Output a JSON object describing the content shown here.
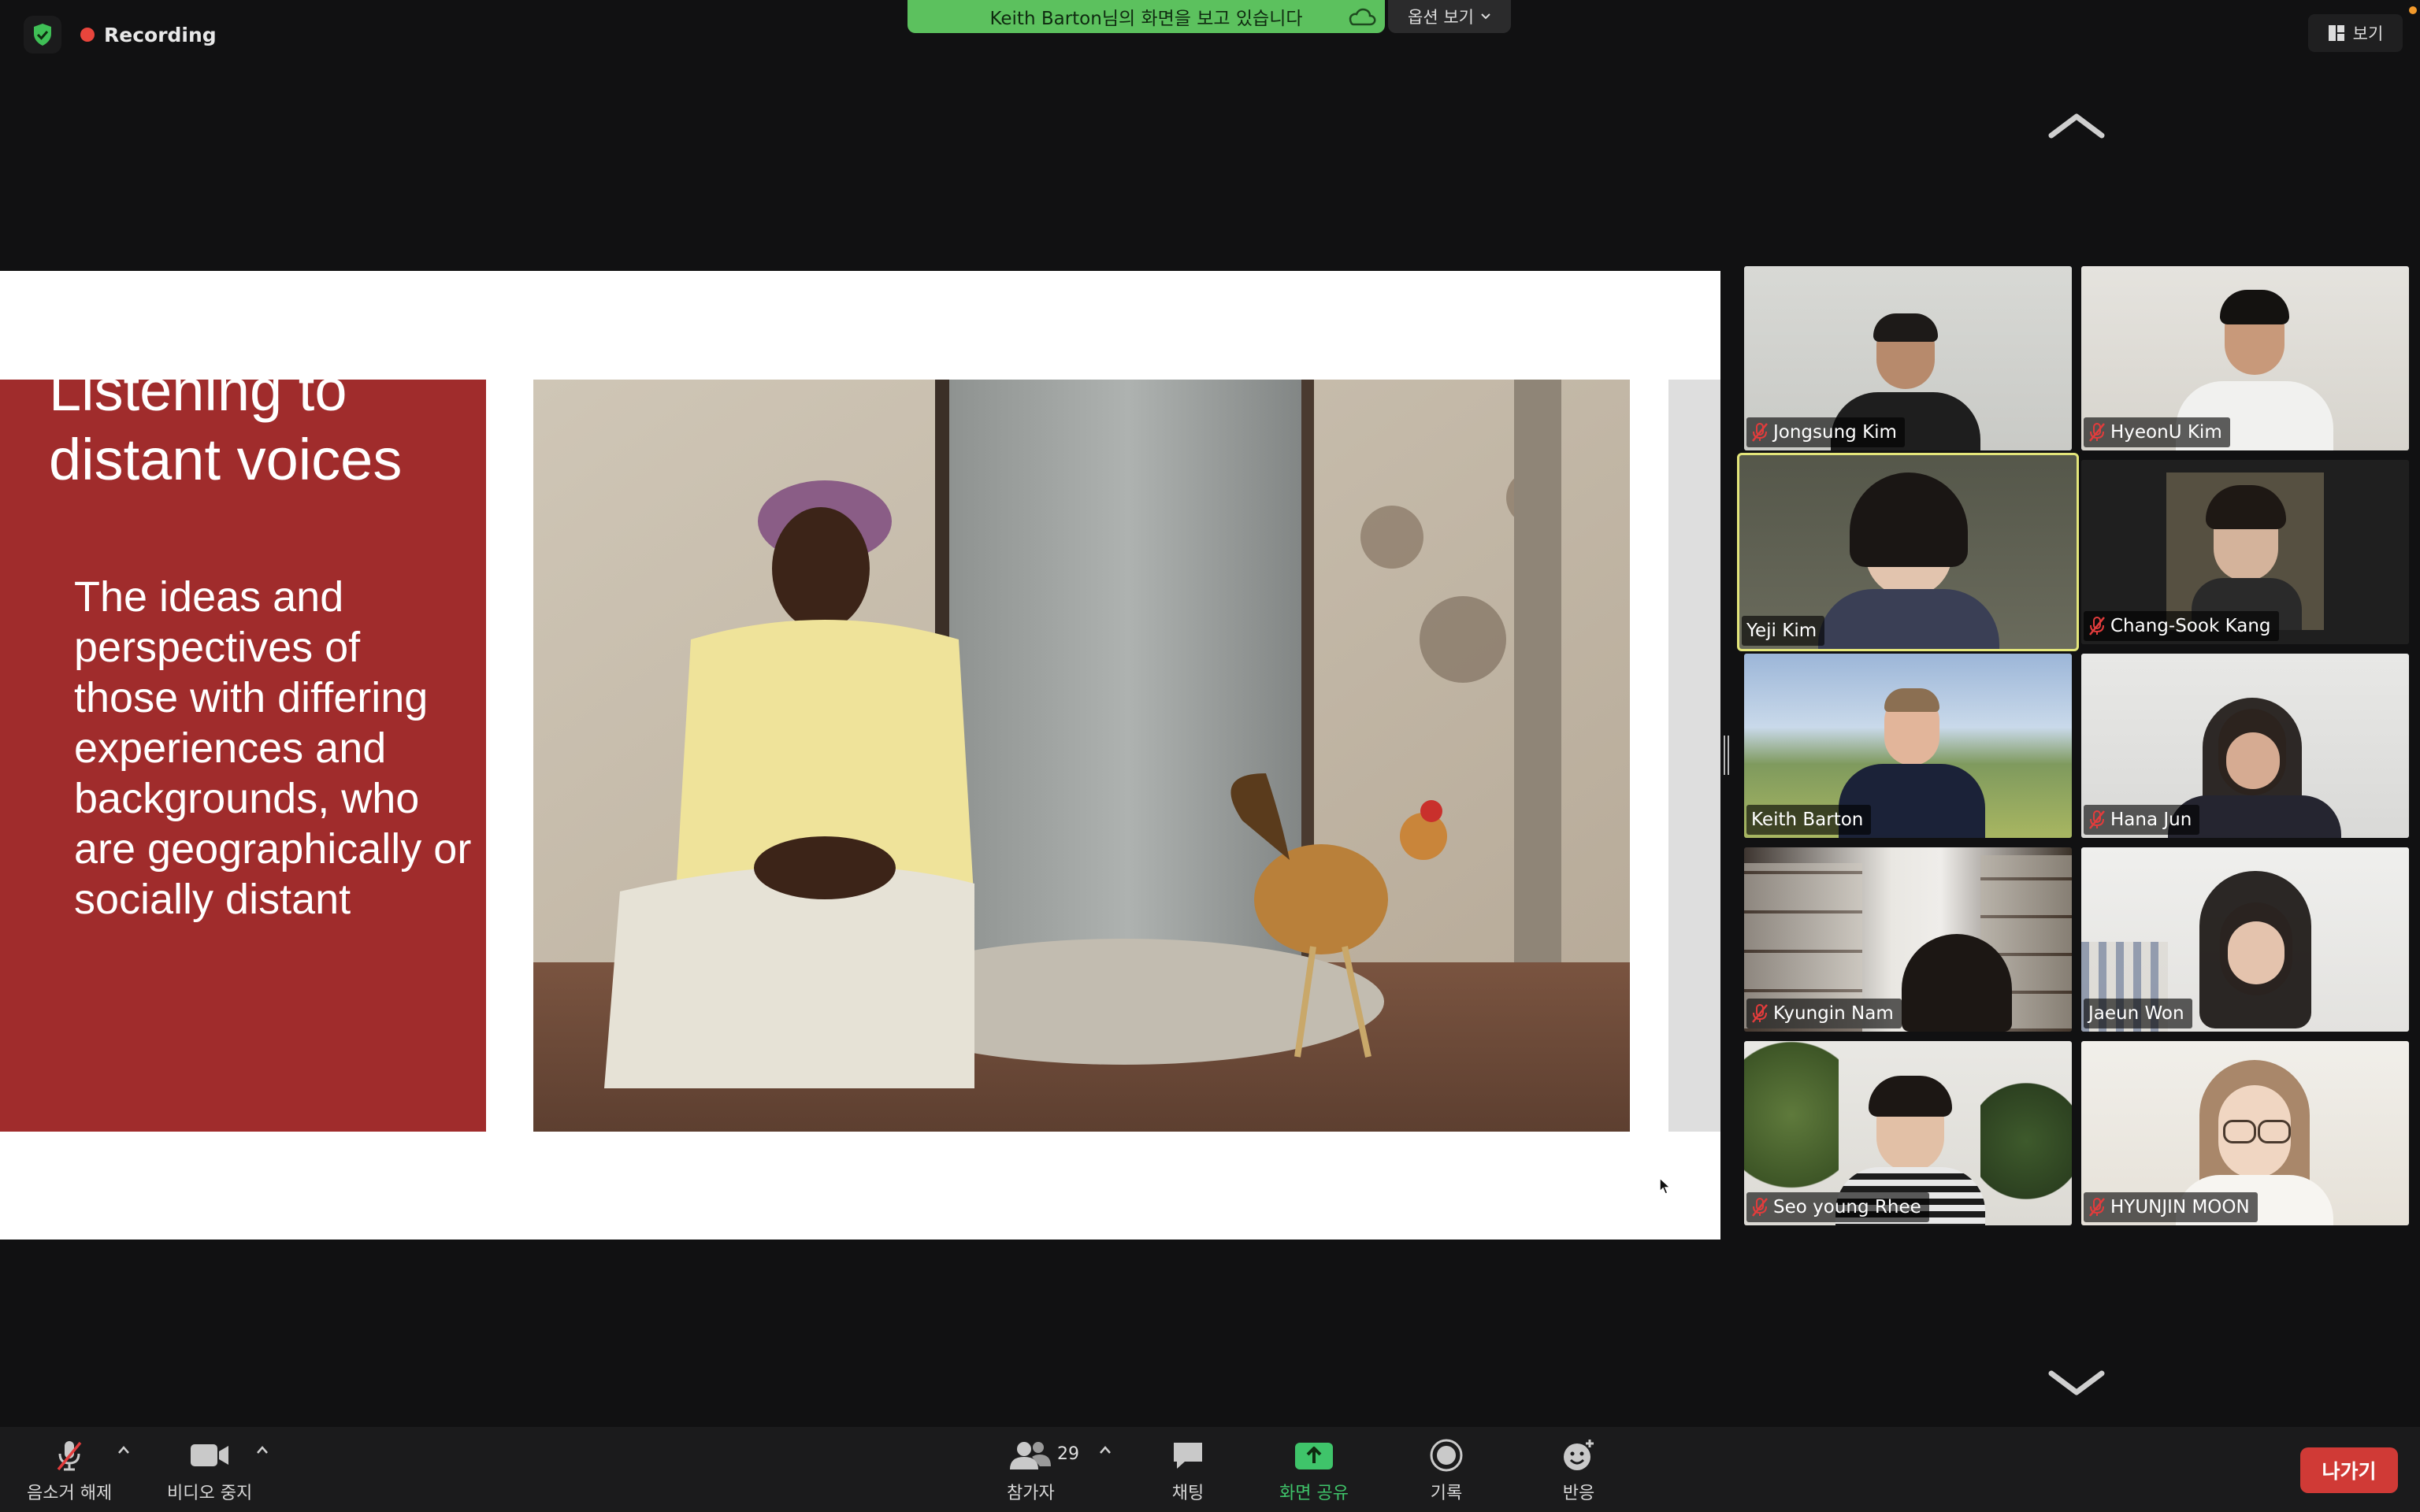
{
  "top_bar": {
    "recording_label": "Recording",
    "share_banner_text": "Keith Barton님의 화면을 보고 있습니다",
    "options_label": "옵션 보기",
    "view_label": "보기",
    "colors": {
      "banner": "#5cc15e",
      "recording_dot": "#e8453c"
    }
  },
  "slide": {
    "title": "Listening to distant voices",
    "body": "The ideas and perspectives of those with differing experiences and backgrounds, who are geographically or socially distant",
    "colors": {
      "panel": "#a02c2c"
    }
  },
  "participants": [
    {
      "name": "Jongsung Kim",
      "muted": true
    },
    {
      "name": "HyeonU Kim",
      "muted": true
    },
    {
      "name": "Yeji Kim",
      "muted": false,
      "speaking": true
    },
    {
      "name": "Chang-Sook Kang",
      "muted": true
    },
    {
      "name": "Keith Barton",
      "muted": false
    },
    {
      "name": "Hana Jun",
      "muted": true
    },
    {
      "name": "Kyungin Nam",
      "muted": true
    },
    {
      "name": "Jaeun Won",
      "muted": false
    },
    {
      "name": "Seo young Rhee",
      "muted": true
    },
    {
      "name": "HYUNJIN MOON",
      "muted": true
    }
  ],
  "toolbar": {
    "unmute_label": "음소거 해제",
    "video_label": "비디오 중지",
    "participants_label": "참가자",
    "participants_count": "29",
    "chat_label": "채팅",
    "share_label": "화면 공유",
    "record_label": "기록",
    "reactions_label": "반응",
    "leave_label": "나가기",
    "colors": {
      "share": "#3fc46a",
      "leave": "#d03a36"
    }
  }
}
